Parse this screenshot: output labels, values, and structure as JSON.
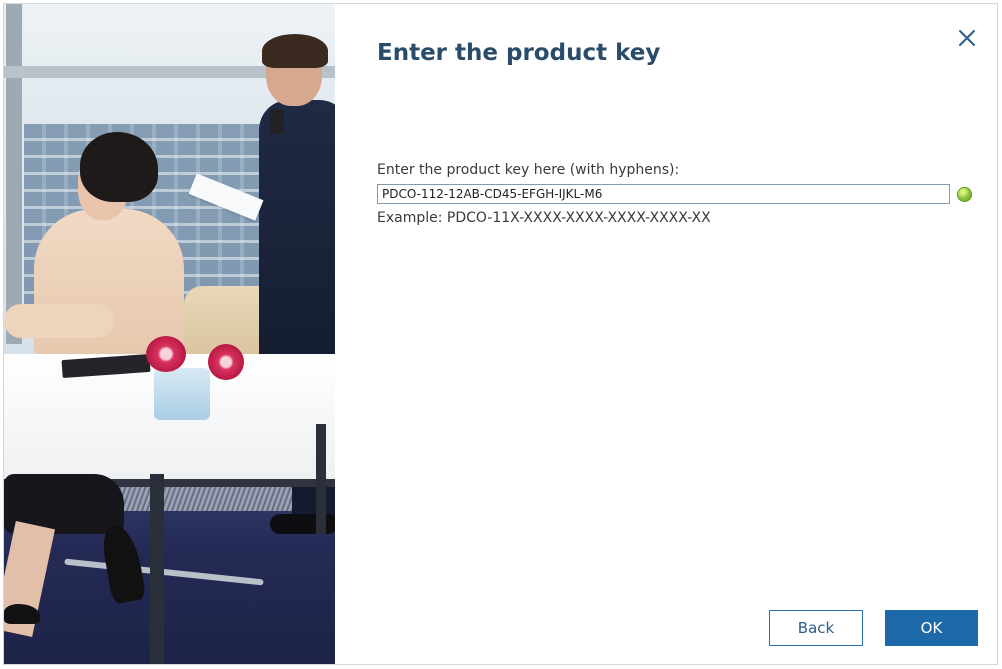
{
  "dialog": {
    "title": "Enter the product key",
    "close_icon": "close-icon"
  },
  "product_key": {
    "label": "Enter the product key here (with hyphens):",
    "value": "PDCO-112-12AB-CD45-EFGH-IJKL-M6",
    "valid_icon": "check-circle-icon",
    "example": "Example: PDCO-11X-XXXX-XXXX-XXXX-XXXX-XX"
  },
  "buttons": {
    "back_label": "Back",
    "ok_label": "OK"
  },
  "colors": {
    "title": "#2a4c6b",
    "primary": "#1e6aa8",
    "valid": "#8cc63f"
  }
}
